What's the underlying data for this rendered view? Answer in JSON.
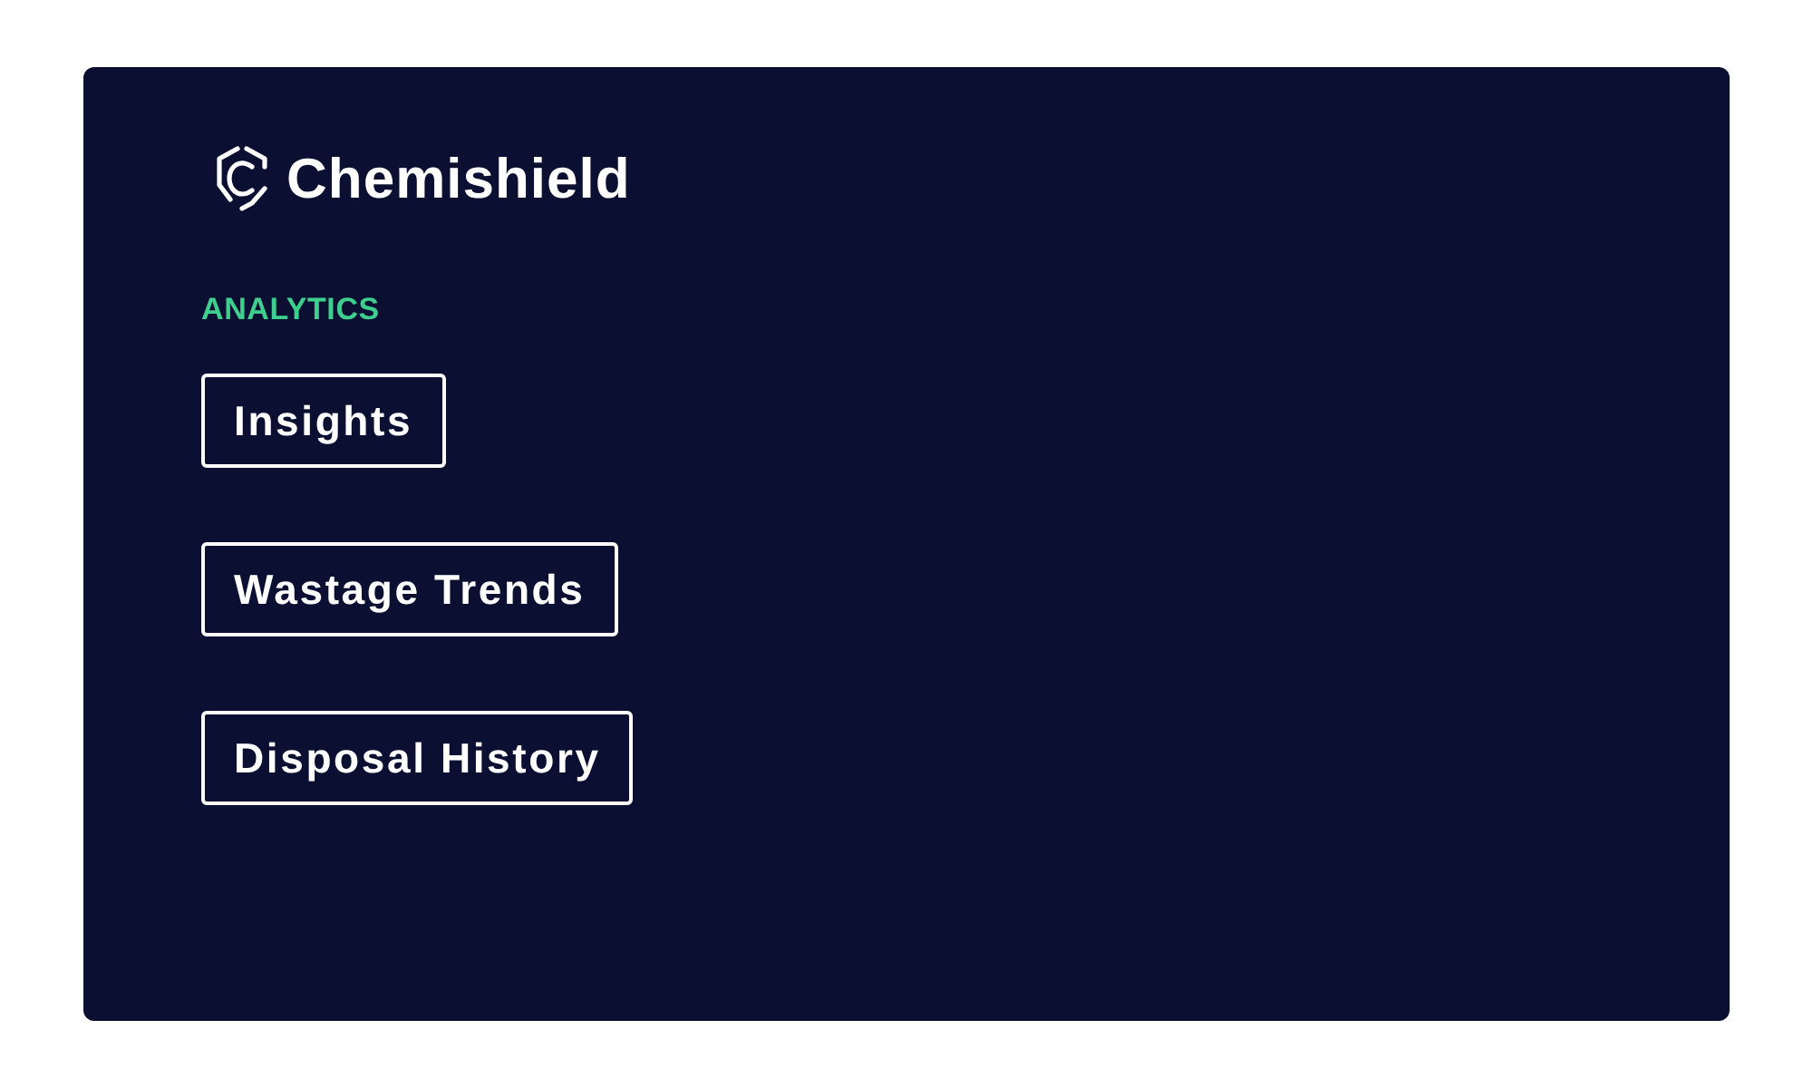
{
  "brand": {
    "name": "Chemishield"
  },
  "nav": {
    "section": "ANALYTICS",
    "items": [
      {
        "label": "Insights"
      },
      {
        "label": "Wastage Trends"
      },
      {
        "label": "Disposal History"
      }
    ]
  }
}
